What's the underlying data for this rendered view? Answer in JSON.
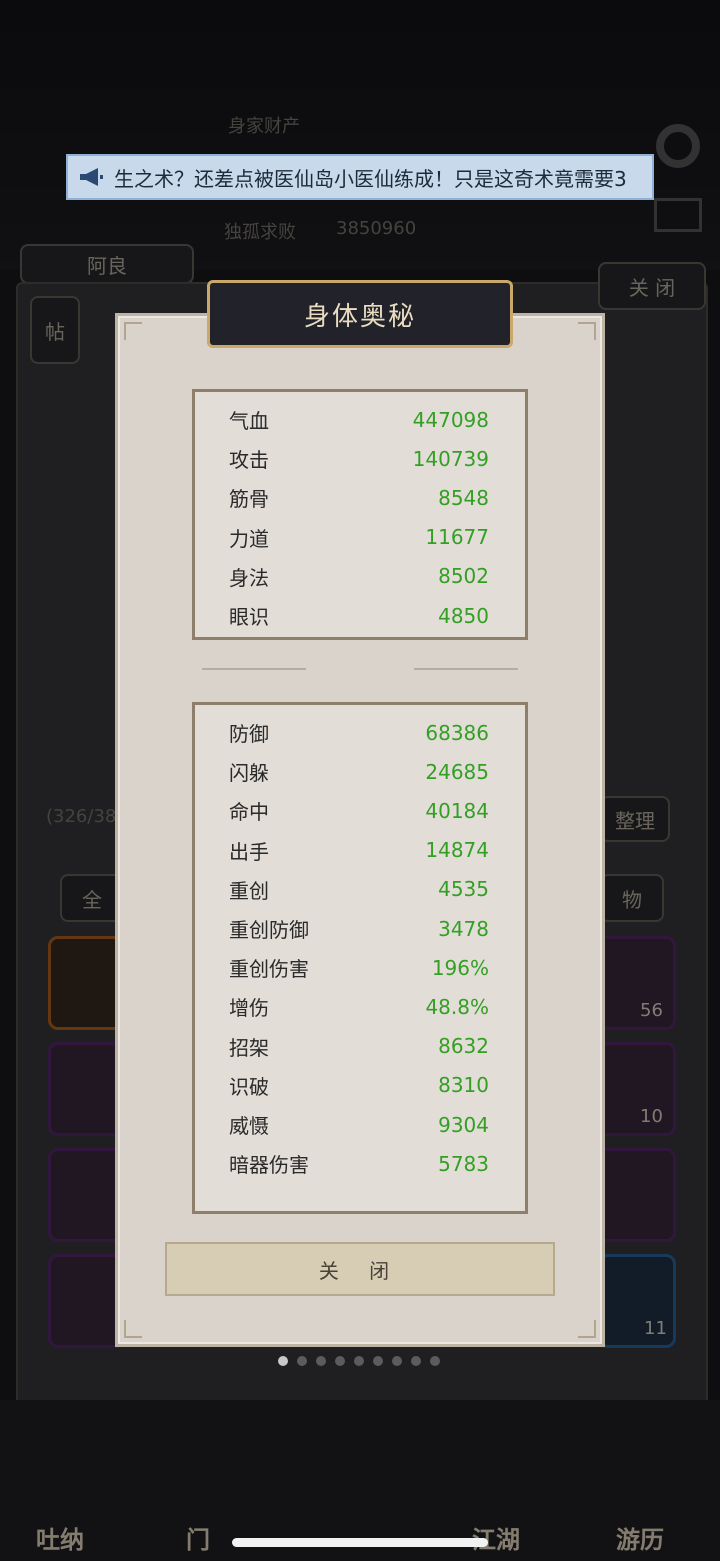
{
  "background": {
    "top_label": "身家财产",
    "stat_label": "独孤求败",
    "stat_value": "3850960",
    "player_name": "阿良",
    "top_close": "关 闭",
    "post_button": "帖",
    "inventory_count": "(326/38",
    "sort_button": "整理",
    "filter_all": "全",
    "filter_items": "物",
    "item_counts": [
      "56",
      "10",
      "11"
    ],
    "bottom_tabs": [
      "吐纳",
      "门",
      "江湖",
      "游历"
    ]
  },
  "announcement": {
    "text": "生之术？还差点被医仙岛小医仙练成！只是这奇术竟需要3"
  },
  "modal": {
    "title": "身体奥秘",
    "primary_stats": [
      {
        "label": "气血",
        "value": "447098"
      },
      {
        "label": "攻击",
        "value": "140739"
      },
      {
        "label": "筋骨",
        "value": "8548"
      },
      {
        "label": "力道",
        "value": "11677"
      },
      {
        "label": "身法",
        "value": "8502"
      },
      {
        "label": "眼识",
        "value": "4850"
      }
    ],
    "secondary_stats": [
      {
        "label": "防御",
        "value": "68386"
      },
      {
        "label": "闪躲",
        "value": "24685"
      },
      {
        "label": "命中",
        "value": "40184"
      },
      {
        "label": "出手",
        "value": "14874"
      },
      {
        "label": "重创",
        "value": "4535"
      },
      {
        "label": "重创防御",
        "value": "3478"
      },
      {
        "label": "重创伤害",
        "value": "196%"
      },
      {
        "label": "增伤",
        "value": "48.8%"
      },
      {
        "label": "招架",
        "value": "8632"
      },
      {
        "label": "识破",
        "value": "8310"
      },
      {
        "label": "威慑",
        "value": "9304"
      },
      {
        "label": "暗器伤害",
        "value": "5783"
      }
    ],
    "close_label": "关 闭"
  },
  "colors": {
    "stat_value": "#33a024",
    "modal_bg": "#d9d3cc",
    "title_bg": "#22222a"
  }
}
